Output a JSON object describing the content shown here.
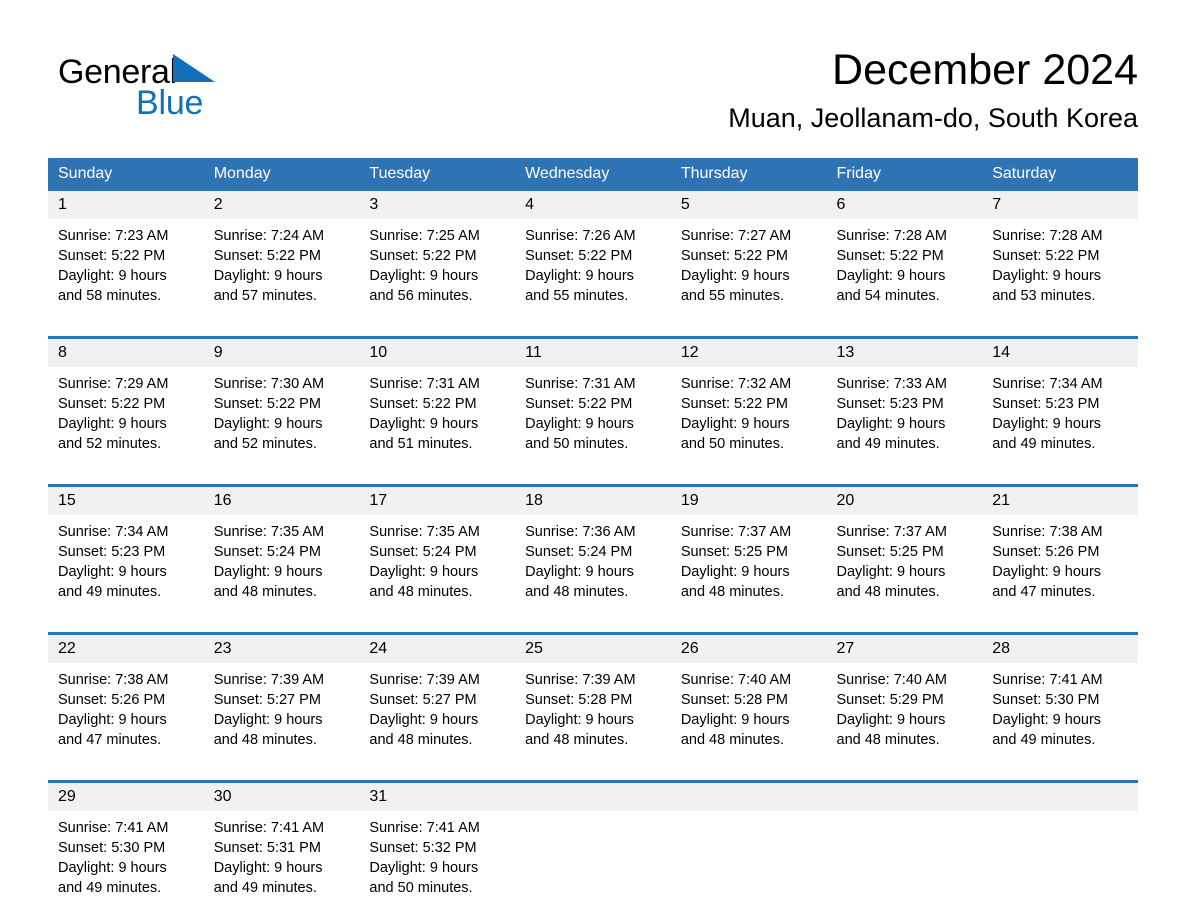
{
  "brand": {
    "name_part1": "General",
    "name_part2": "Blue",
    "triangle_color": "#1270b8",
    "logo_icon": "triangle-icon"
  },
  "header": {
    "title": "December 2024",
    "subtitle": "Muan, Jeollanam-do, South Korea"
  },
  "theme": {
    "header_blue": "#2e74b5",
    "daynum_gray": "#f1f1f1",
    "text_black": "#000000",
    "brand_blue": "#1270b8"
  },
  "weekdays": [
    "Sunday",
    "Monday",
    "Tuesday",
    "Wednesday",
    "Thursday",
    "Friday",
    "Saturday"
  ],
  "weeks": [
    {
      "days": [
        {
          "num": "1",
          "sunrise": "Sunrise: 7:23 AM",
          "sunset": "Sunset: 5:22 PM",
          "daylight1": "Daylight: 9 hours",
          "daylight2": "and 58 minutes."
        },
        {
          "num": "2",
          "sunrise": "Sunrise: 7:24 AM",
          "sunset": "Sunset: 5:22 PM",
          "daylight1": "Daylight: 9 hours",
          "daylight2": "and 57 minutes."
        },
        {
          "num": "3",
          "sunrise": "Sunrise: 7:25 AM",
          "sunset": "Sunset: 5:22 PM",
          "daylight1": "Daylight: 9 hours",
          "daylight2": "and 56 minutes."
        },
        {
          "num": "4",
          "sunrise": "Sunrise: 7:26 AM",
          "sunset": "Sunset: 5:22 PM",
          "daylight1": "Daylight: 9 hours",
          "daylight2": "and 55 minutes."
        },
        {
          "num": "5",
          "sunrise": "Sunrise: 7:27 AM",
          "sunset": "Sunset: 5:22 PM",
          "daylight1": "Daylight: 9 hours",
          "daylight2": "and 55 minutes."
        },
        {
          "num": "6",
          "sunrise": "Sunrise: 7:28 AM",
          "sunset": "Sunset: 5:22 PM",
          "daylight1": "Daylight: 9 hours",
          "daylight2": "and 54 minutes."
        },
        {
          "num": "7",
          "sunrise": "Sunrise: 7:28 AM",
          "sunset": "Sunset: 5:22 PM",
          "daylight1": "Daylight: 9 hours",
          "daylight2": "and 53 minutes."
        }
      ]
    },
    {
      "days": [
        {
          "num": "8",
          "sunrise": "Sunrise: 7:29 AM",
          "sunset": "Sunset: 5:22 PM",
          "daylight1": "Daylight: 9 hours",
          "daylight2": "and 52 minutes."
        },
        {
          "num": "9",
          "sunrise": "Sunrise: 7:30 AM",
          "sunset": "Sunset: 5:22 PM",
          "daylight1": "Daylight: 9 hours",
          "daylight2": "and 52 minutes."
        },
        {
          "num": "10",
          "sunrise": "Sunrise: 7:31 AM",
          "sunset": "Sunset: 5:22 PM",
          "daylight1": "Daylight: 9 hours",
          "daylight2": "and 51 minutes."
        },
        {
          "num": "11",
          "sunrise": "Sunrise: 7:31 AM",
          "sunset": "Sunset: 5:22 PM",
          "daylight1": "Daylight: 9 hours",
          "daylight2": "and 50 minutes."
        },
        {
          "num": "12",
          "sunrise": "Sunrise: 7:32 AM",
          "sunset": "Sunset: 5:22 PM",
          "daylight1": "Daylight: 9 hours",
          "daylight2": "and 50 minutes."
        },
        {
          "num": "13",
          "sunrise": "Sunrise: 7:33 AM",
          "sunset": "Sunset: 5:23 PM",
          "daylight1": "Daylight: 9 hours",
          "daylight2": "and 49 minutes."
        },
        {
          "num": "14",
          "sunrise": "Sunrise: 7:34 AM",
          "sunset": "Sunset: 5:23 PM",
          "daylight1": "Daylight: 9 hours",
          "daylight2": "and 49 minutes."
        }
      ]
    },
    {
      "days": [
        {
          "num": "15",
          "sunrise": "Sunrise: 7:34 AM",
          "sunset": "Sunset: 5:23 PM",
          "daylight1": "Daylight: 9 hours",
          "daylight2": "and 49 minutes."
        },
        {
          "num": "16",
          "sunrise": "Sunrise: 7:35 AM",
          "sunset": "Sunset: 5:24 PM",
          "daylight1": "Daylight: 9 hours",
          "daylight2": "and 48 minutes."
        },
        {
          "num": "17",
          "sunrise": "Sunrise: 7:35 AM",
          "sunset": "Sunset: 5:24 PM",
          "daylight1": "Daylight: 9 hours",
          "daylight2": "and 48 minutes."
        },
        {
          "num": "18",
          "sunrise": "Sunrise: 7:36 AM",
          "sunset": "Sunset: 5:24 PM",
          "daylight1": "Daylight: 9 hours",
          "daylight2": "and 48 minutes."
        },
        {
          "num": "19",
          "sunrise": "Sunrise: 7:37 AM",
          "sunset": "Sunset: 5:25 PM",
          "daylight1": "Daylight: 9 hours",
          "daylight2": "and 48 minutes."
        },
        {
          "num": "20",
          "sunrise": "Sunrise: 7:37 AM",
          "sunset": "Sunset: 5:25 PM",
          "daylight1": "Daylight: 9 hours",
          "daylight2": "and 48 minutes."
        },
        {
          "num": "21",
          "sunrise": "Sunrise: 7:38 AM",
          "sunset": "Sunset: 5:26 PM",
          "daylight1": "Daylight: 9 hours",
          "daylight2": "and 47 minutes."
        }
      ]
    },
    {
      "days": [
        {
          "num": "22",
          "sunrise": "Sunrise: 7:38 AM",
          "sunset": "Sunset: 5:26 PM",
          "daylight1": "Daylight: 9 hours",
          "daylight2": "and 47 minutes."
        },
        {
          "num": "23",
          "sunrise": "Sunrise: 7:39 AM",
          "sunset": "Sunset: 5:27 PM",
          "daylight1": "Daylight: 9 hours",
          "daylight2": "and 48 minutes."
        },
        {
          "num": "24",
          "sunrise": "Sunrise: 7:39 AM",
          "sunset": "Sunset: 5:27 PM",
          "daylight1": "Daylight: 9 hours",
          "daylight2": "and 48 minutes."
        },
        {
          "num": "25",
          "sunrise": "Sunrise: 7:39 AM",
          "sunset": "Sunset: 5:28 PM",
          "daylight1": "Daylight: 9 hours",
          "daylight2": "and 48 minutes."
        },
        {
          "num": "26",
          "sunrise": "Sunrise: 7:40 AM",
          "sunset": "Sunset: 5:28 PM",
          "daylight1": "Daylight: 9 hours",
          "daylight2": "and 48 minutes."
        },
        {
          "num": "27",
          "sunrise": "Sunrise: 7:40 AM",
          "sunset": "Sunset: 5:29 PM",
          "daylight1": "Daylight: 9 hours",
          "daylight2": "and 48 minutes."
        },
        {
          "num": "28",
          "sunrise": "Sunrise: 7:41 AM",
          "sunset": "Sunset: 5:30 PM",
          "daylight1": "Daylight: 9 hours",
          "daylight2": "and 49 minutes."
        }
      ]
    },
    {
      "days": [
        {
          "num": "29",
          "sunrise": "Sunrise: 7:41 AM",
          "sunset": "Sunset: 5:30 PM",
          "daylight1": "Daylight: 9 hours",
          "daylight2": "and 49 minutes."
        },
        {
          "num": "30",
          "sunrise": "Sunrise: 7:41 AM",
          "sunset": "Sunset: 5:31 PM",
          "daylight1": "Daylight: 9 hours",
          "daylight2": "and 49 minutes."
        },
        {
          "num": "31",
          "sunrise": "Sunrise: 7:41 AM",
          "sunset": "Sunset: 5:32 PM",
          "daylight1": "Daylight: 9 hours",
          "daylight2": "and 50 minutes."
        },
        {
          "num": "",
          "sunrise": "",
          "sunset": "",
          "daylight1": "",
          "daylight2": ""
        },
        {
          "num": "",
          "sunrise": "",
          "sunset": "",
          "daylight1": "",
          "daylight2": ""
        },
        {
          "num": "",
          "sunrise": "",
          "sunset": "",
          "daylight1": "",
          "daylight2": ""
        },
        {
          "num": "",
          "sunrise": "",
          "sunset": "",
          "daylight1": "",
          "daylight2": ""
        }
      ]
    }
  ]
}
